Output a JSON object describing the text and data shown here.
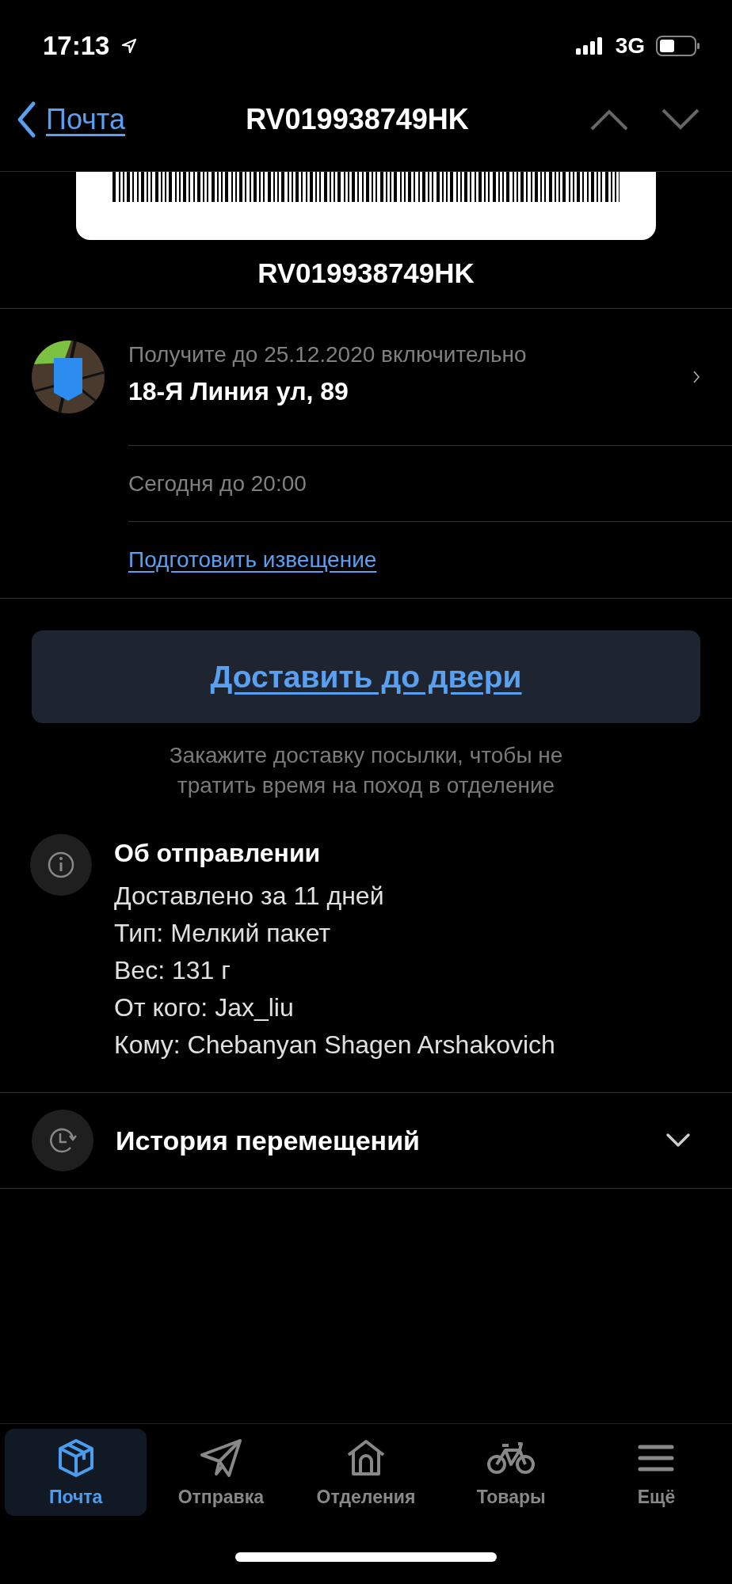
{
  "status_bar": {
    "time": "17:13",
    "network": "3G"
  },
  "nav": {
    "back_label": "Почта",
    "title": "RV019938749HK"
  },
  "tracking_number": "RV019938749HK",
  "pickup": {
    "deadline": "Получите до 25.12.2020 включительно",
    "address": "18-Я Линия ул, 89",
    "hours": "Сегодня до 20:00",
    "notice_link": "Подготовить извещение"
  },
  "delivery": {
    "button": "Доставить до двери",
    "caption": "Закажите доставку посылки, чтобы не тратить время на поход в отделение"
  },
  "about": {
    "title": "Об отправлении",
    "lines": [
      "Доставлено за 11 дней",
      "Тип: Мелкий пакет",
      "Вес: 131 г",
      "От кого: Jax_liu",
      "Кому: Chebanyan Shagen Arshakovich"
    ]
  },
  "history": {
    "title": "История перемещений",
    "expanded": false
  },
  "tabs": [
    {
      "label": "Почта",
      "selected": true
    },
    {
      "label": "Отправка",
      "selected": false
    },
    {
      "label": "Отделения",
      "selected": false
    },
    {
      "label": "Товары",
      "selected": false
    },
    {
      "label": "Ещё",
      "selected": false
    }
  ]
}
